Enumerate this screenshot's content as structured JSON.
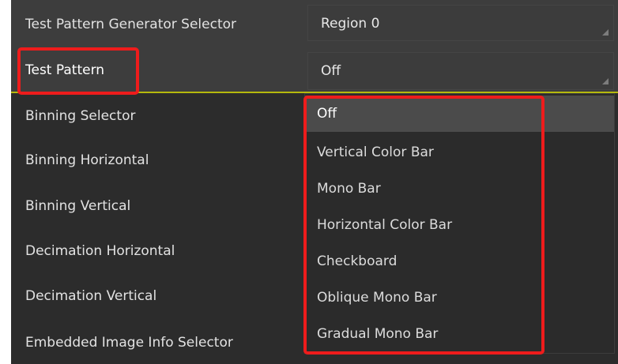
{
  "properties": [
    {
      "label": "Test Pattern Generator Selector",
      "value": "Region 0"
    },
    {
      "label": "Test Pattern",
      "value": "Off"
    },
    {
      "label": "Binning Selector"
    },
    {
      "label": "Binning Horizontal"
    },
    {
      "label": "Binning Vertical"
    },
    {
      "label": "Decimation Horizontal"
    },
    {
      "label": "Decimation Vertical"
    },
    {
      "label": "Embedded Image Info Selector"
    }
  ],
  "dropdown": {
    "selected": "Off",
    "options": [
      "Off",
      "Vertical Color Bar",
      "Mono Bar",
      "Horizontal Color Bar",
      "Checkboard",
      "Oblique Mono Bar",
      "Gradual Mono Bar"
    ]
  },
  "colors": {
    "panel_bg": "#2c2c2c",
    "row_header_bg": "#3d3d3d",
    "active_underline": "#b5b90d",
    "highlight_frame": "#ee1c1c"
  }
}
